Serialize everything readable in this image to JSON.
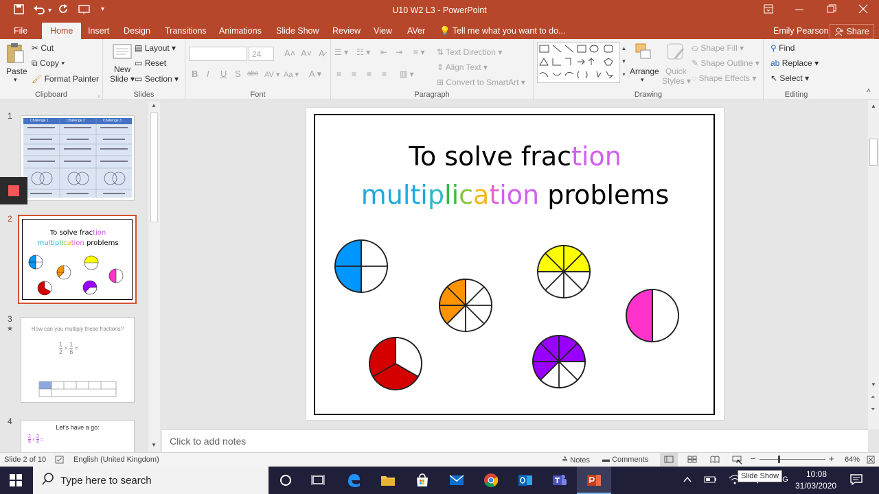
{
  "window": {
    "title": "U10 W2 L3 - PowerPoint",
    "user": "Emily Pearson",
    "share_label": "Share"
  },
  "tabs": [
    "File",
    "Home",
    "Insert",
    "Design",
    "Transitions",
    "Animations",
    "Slide Show",
    "Review",
    "View",
    "AVer"
  ],
  "tell_me": "Tell me what you want to do...",
  "ribbon": {
    "clipboard": {
      "label": "Clipboard",
      "paste": "Paste",
      "cut": "Cut",
      "copy": "Copy",
      "format_painter": "Format Painter"
    },
    "slides": {
      "label": "Slides",
      "new_slide_1": "New",
      "new_slide_2": "Slide",
      "layout": "Layout",
      "reset": "Reset",
      "section": "Section"
    },
    "font": {
      "label": "Font",
      "size": "24"
    },
    "paragraph": {
      "label": "Paragraph",
      "text_direction": "Text Direction",
      "align_text": "Align Text",
      "convert": "Convert to SmartArt"
    },
    "drawing": {
      "label": "Drawing",
      "arrange": "Arrange",
      "quick_1": "Quick",
      "quick_2": "Styles",
      "shape_fill": "Shape Fill",
      "shape_outline": "Shape Outline",
      "shape_effects": "Shape Effects"
    },
    "editing": {
      "label": "Editing",
      "find": "Find",
      "replace": "Replace",
      "select": "Select"
    }
  },
  "thumbnails": {
    "n1": "1",
    "n2": "2",
    "n3": "3",
    "n4": "4",
    "t2_line1a": "To solve frac",
    "t2_line1b": "tion",
    "t2_line2": "multiplication",
    "t2_line2b": " problems",
    "t3_text": "How can you multiply these fractions?",
    "t3_n1": "1",
    "t3_d1": "2",
    "t3_x": "×",
    "t3_n2": "1",
    "t3_d2": "6",
    "t3_eq": "=",
    "t4_text": "Let's have a go:",
    "t4_n1": "2",
    "t4_d1": "5",
    "t4_x": "×",
    "t4_n2": "3",
    "t4_d2": "4",
    "t4_eq": "=",
    "t1_h1": "Challenge 1",
    "t1_h2": "Challenge 2",
    "t1_h3": "Challenge 3"
  },
  "slide": {
    "line1_black": "To solve frac",
    "line1_color": "tion",
    "line2_black": " problems"
  },
  "notes_placeholder": "Click to add notes",
  "status": {
    "slide": "Slide 2 of 10",
    "language": "English (United Kingdom)",
    "notes": "Notes",
    "comments": "Comments",
    "zoom": "64%"
  },
  "tooltip": "Slide Show",
  "taskbar": {
    "search": "Type here to search",
    "time": "10:08",
    "date": "31/03/2020",
    "lang": "ENG"
  },
  "colors": {
    "accent": "#b7472a",
    "blue": "#0096ff",
    "orange": "#ff9300",
    "yellow": "#ffff00",
    "pink": "#ff33cc",
    "red": "#d40000",
    "purple": "#9900ff"
  }
}
